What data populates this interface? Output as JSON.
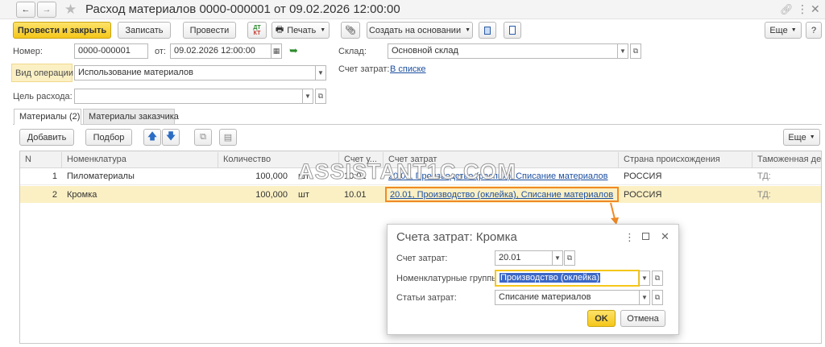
{
  "window": {
    "title": "Расход материалов 0000-000001 от 09.02.2026 12:00:00"
  },
  "toolbar": {
    "post_close": "Провести и закрыть",
    "save": "Записать",
    "post": "Провести",
    "print": "Печать",
    "create_based": "Создать на основании",
    "more": "Еще",
    "help": "?"
  },
  "form": {
    "number_label": "Номер:",
    "number_value": "0000-000001",
    "date_label": "от:",
    "date_value": "09.02.2026 12:00:00",
    "warehouse_label": "Склад:",
    "warehouse_value": "Основной склад",
    "optype_label": "Вид операции:",
    "optype_value": "Использование материалов",
    "cost_account_label": "Счет затрат:",
    "cost_account_link": "В списке",
    "purpose_label": "Цель расхода:",
    "purpose_value": ""
  },
  "tabs": [
    {
      "label": "Материалы (2)"
    },
    {
      "label": "Материалы заказчика"
    }
  ],
  "table_toolbar": {
    "add": "Добавить",
    "select": "Подбор",
    "more": "Еще"
  },
  "table": {
    "columns": [
      "N",
      "Номенклатура",
      "Количество",
      "Счет у...",
      "Счет затрат",
      "Страна происхождения",
      "Таможенная дек"
    ],
    "rows": [
      {
        "n": "1",
        "item": "Пиломатериалы",
        "qty": "100,000",
        "unit": "шт",
        "acct": "10.01",
        "cost": "20.01, Производство (распил), Списание материалов",
        "country": "РОССИЯ",
        "customs": "ТД:"
      },
      {
        "n": "2",
        "item": "Кромка",
        "qty": "100,000",
        "unit": "шт",
        "acct": "10.01",
        "cost": "20.01, Производство (оклейка), Списание материалов",
        "country": "РОССИЯ",
        "customs": "ТД:"
      }
    ]
  },
  "watermark": "ASSISTANT1C.COM",
  "popup": {
    "title": "Счета затрат: Кромка",
    "account_label": "Счет затрат:",
    "account_value": "20.01",
    "groups_label": "Номенклатурные группы:",
    "groups_value": "Производство (оклейка)",
    "items_label": "Статьи затрат:",
    "items_value": "Списание материалов",
    "ok": "OK",
    "cancel": "Отмена"
  },
  "colors": {
    "accent_yellow": "#f5c71a",
    "highlight_row": "#fbf0c4",
    "orange_annotation": "#f08a24",
    "link_blue": "#1c4fa0"
  }
}
